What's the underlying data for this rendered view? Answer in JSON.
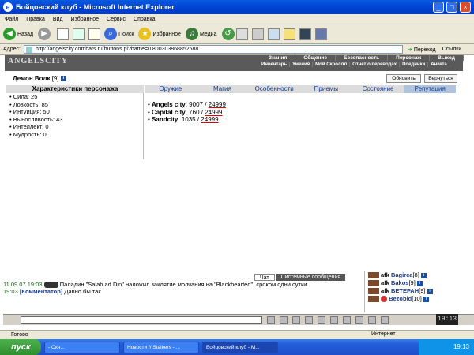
{
  "window": {
    "title": "Бойцовский клуб - Microsoft Internet Explorer"
  },
  "menu": [
    "Файл",
    "Правка",
    "Вид",
    "Избранное",
    "Сервис",
    "Справка"
  ],
  "toolbar": {
    "back": "Назад",
    "search": "Поиск",
    "favorites": "Избранное",
    "media": "Медиа"
  },
  "address": {
    "label": "Адрес:",
    "url": "http://angelscity.combats.ru/buttons.pl?battle=0.800303868852588",
    "go": "Переход",
    "links": "Ссылки"
  },
  "game": {
    "logo": "ANGELSCITY",
    "top_menu": [
      "Знания",
      "Общение",
      "Безопасность",
      "Персонаж",
      "Выход"
    ],
    "sub_menu": [
      "Инвентарь",
      "Умения",
      "Мой Скроллл",
      "Отчет о переводах",
      "Поединки",
      "Анкета"
    ],
    "character": {
      "name": "Демон Волк",
      "level": "[9]"
    },
    "buttons": {
      "refresh": "Обновить",
      "back": "Вернуться"
    },
    "stats_header": "Характеристики персонажа",
    "stats": [
      "Сила: 25",
      "Ловкость: 85",
      "Интуиция: 50",
      "Выносливость: 43",
      "Интеллект: 0",
      "Мудрость: 0"
    ],
    "tabs": [
      "Оружие",
      "Магия",
      "Особенности",
      "Приемы",
      "Состояние",
      "Репутация"
    ],
    "reputation": [
      {
        "city": "Angels city",
        "value": "9007",
        "max": "24999"
      },
      {
        "city": "Capital city",
        "value": "760",
        "max": "24999"
      },
      {
        "city": "Sandcity",
        "value": "1035",
        "max": "24999"
      }
    ]
  },
  "chat": {
    "tabs": [
      "Чат",
      "Системные сообщения"
    ],
    "messages": [
      {
        "time": "11.09.07 19:03",
        "text": "Паладин \"Salah ad Din\" наложил заклятие молчания на \"Blackhearted\", сроком одни сутки"
      },
      {
        "time": "19:03",
        "author": "[Комментатор]",
        "text": "Давно бы так"
      }
    ]
  },
  "online": [
    {
      "prefix": "afk",
      "name": "Bagirca",
      "level": "[8]"
    },
    {
      "prefix": "afk",
      "name": "Bakos",
      "level": "[9]"
    },
    {
      "prefix": "afk",
      "name": "ВЕТЕРАН",
      "level": "[9]"
    },
    {
      "prefix": "",
      "name": "Bezobid",
      "level": "[10]"
    }
  ],
  "clock": "19:13",
  "statusbar": {
    "left": "Готово",
    "zone": "Интернет"
  },
  "taskbar": {
    "start": "пуск",
    "tasks": [
      "- Окн...",
      "Новости // Stalkers - ...",
      "Бойцовский клуб - M..."
    ],
    "tray_time": "19:13"
  }
}
